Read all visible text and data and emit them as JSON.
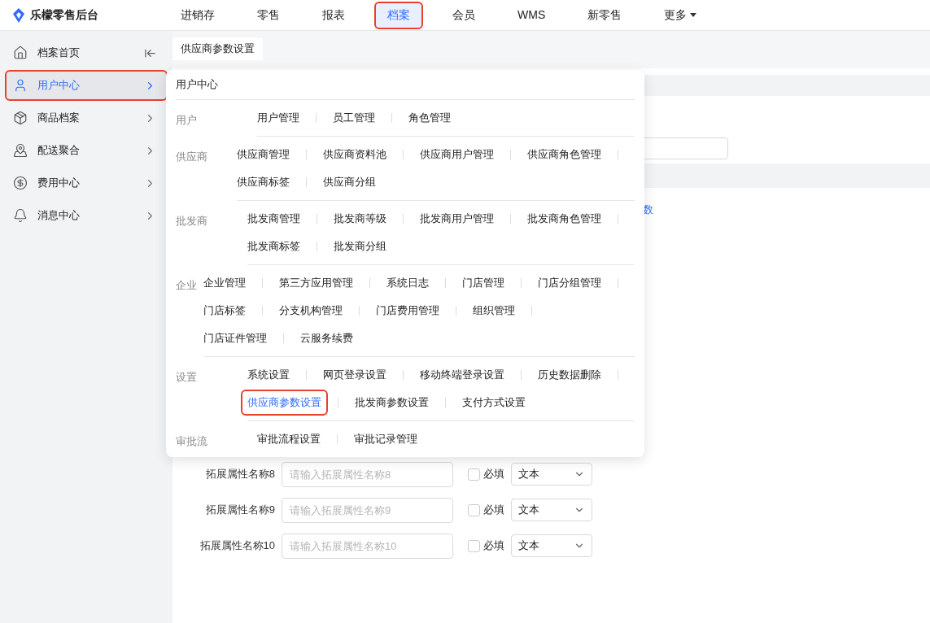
{
  "logo": {
    "text": "乐檬零售后台"
  },
  "top_nav": [
    {
      "label": "进销存",
      "selected": false,
      "annotated": false,
      "kind": "link"
    },
    {
      "label": "零售",
      "selected": false,
      "annotated": false,
      "kind": "link"
    },
    {
      "label": "报表",
      "selected": false,
      "annotated": false,
      "kind": "link"
    },
    {
      "label": "档案",
      "selected": true,
      "annotated": true,
      "kind": "link"
    },
    {
      "label": "会员",
      "selected": false,
      "annotated": false,
      "kind": "link"
    },
    {
      "label": "WMS",
      "selected": false,
      "annotated": false,
      "kind": "link"
    },
    {
      "label": "新零售",
      "selected": false,
      "annotated": false,
      "kind": "link"
    },
    {
      "label": "更多",
      "selected": false,
      "annotated": false,
      "kind": "dropdown"
    }
  ],
  "sidebar": {
    "items": [
      {
        "label": "档案首页",
        "kind": "home",
        "selected": false,
        "annotated": false
      },
      {
        "label": "用户中心",
        "kind": "group",
        "selected": true,
        "annotated": true
      },
      {
        "label": "商品档案",
        "kind": "group",
        "selected": false,
        "annotated": false
      },
      {
        "label": "配送聚合",
        "kind": "group",
        "selected": false,
        "annotated": false
      },
      {
        "label": "费用中心",
        "kind": "group",
        "selected": false,
        "annotated": false
      },
      {
        "label": "消息中心",
        "kind": "group",
        "selected": false,
        "annotated": false
      }
    ]
  },
  "tabs": [
    {
      "label": "供应商参数设置",
      "selected": true
    }
  ],
  "background_form": {
    "link_fragment": "数",
    "rows": [
      {
        "label": "拓展属性名称8",
        "placeholder": "请输入拓展属性名称8",
        "required": false,
        "required_label": "必填",
        "type": "文本"
      },
      {
        "label": "拓展属性名称9",
        "placeholder": "请输入拓展属性名称9",
        "required": false,
        "required_label": "必填",
        "type": "文本"
      },
      {
        "label": "拓展属性名称10",
        "placeholder": "请输入拓展属性名称10",
        "required": false,
        "required_label": "必填",
        "type": "文本"
      }
    ]
  },
  "popup": {
    "title": "用户中心",
    "sections": [
      {
        "label": "用户",
        "rows": [
          [
            {
              "label": "用户管理",
              "selected": false,
              "annotated": false
            },
            {
              "label": "员工管理",
              "selected": false,
              "annotated": false
            },
            {
              "label": "角色管理",
              "selected": false,
              "annotated": false
            }
          ]
        ]
      },
      {
        "label": "供应商",
        "rows": [
          [
            {
              "label": "供应商管理",
              "selected": false,
              "annotated": false
            },
            {
              "label": "供应商资料池",
              "selected": false,
              "annotated": false
            },
            {
              "label": "供应商用户管理",
              "selected": false,
              "annotated": false
            },
            {
              "label": "供应商角色管理",
              "selected": false,
              "annotated": false
            }
          ],
          [
            {
              "label": "供应商标签",
              "selected": false,
              "annotated": false
            },
            {
              "label": "供应商分组",
              "selected": false,
              "annotated": false
            }
          ]
        ]
      },
      {
        "label": "批发商",
        "rows": [
          [
            {
              "label": "批发商管理",
              "selected": false,
              "annotated": false
            },
            {
              "label": "批发商等级",
              "selected": false,
              "annotated": false
            },
            {
              "label": "批发商用户管理",
              "selected": false,
              "annotated": false
            },
            {
              "label": "批发商角色管理",
              "selected": false,
              "annotated": false
            }
          ],
          [
            {
              "label": "批发商标签",
              "selected": false,
              "annotated": false
            },
            {
              "label": "批发商分组",
              "selected": false,
              "annotated": false
            }
          ]
        ]
      },
      {
        "label": "企业",
        "rows": [
          [
            {
              "label": "企业管理",
              "selected": false,
              "annotated": false
            },
            {
              "label": "第三方应用管理",
              "selected": false,
              "annotated": false
            },
            {
              "label": "系统日志",
              "selected": false,
              "annotated": false
            },
            {
              "label": "门店管理",
              "selected": false,
              "annotated": false
            },
            {
              "label": "门店分组管理",
              "selected": false,
              "annotated": false
            }
          ],
          [
            {
              "label": "门店标签",
              "selected": false,
              "annotated": false
            },
            {
              "label": "分支机构管理",
              "selected": false,
              "annotated": false
            },
            {
              "label": "门店费用管理",
              "selected": false,
              "annotated": false
            },
            {
              "label": "组织管理",
              "selected": false,
              "annotated": false
            }
          ],
          [
            {
              "label": "门店证件管理",
              "selected": false,
              "annotated": false
            },
            {
              "label": "云服务续费",
              "selected": false,
              "annotated": false
            }
          ]
        ]
      },
      {
        "label": "设置",
        "rows": [
          [
            {
              "label": "系统设置",
              "selected": false,
              "annotated": false
            },
            {
              "label": "网页登录设置",
              "selected": false,
              "annotated": false
            },
            {
              "label": "移动终端登录设置",
              "selected": false,
              "annotated": false
            },
            {
              "label": "历史数据删除",
              "selected": false,
              "annotated": false
            }
          ],
          [
            {
              "label": "供应商参数设置",
              "selected": true,
              "annotated": true
            },
            {
              "label": "批发商参数设置",
              "selected": false,
              "annotated": false
            },
            {
              "label": "支付方式设置",
              "selected": false,
              "annotated": false
            }
          ]
        ]
      },
      {
        "label": "审批流",
        "rows": [
          [
            {
              "label": "审批流程设置",
              "selected": false,
              "annotated": false
            },
            {
              "label": "审批记录管理",
              "selected": false,
              "annotated": false
            }
          ]
        ]
      }
    ]
  }
}
